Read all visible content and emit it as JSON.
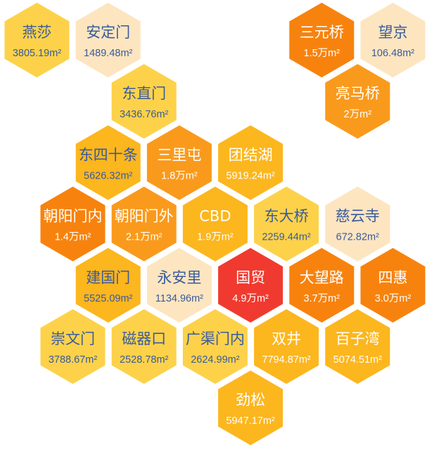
{
  "palette": {
    "light": "#fde5c0",
    "yellow": "#fdd24a",
    "amber": "#fcb61e",
    "orange": "#fa9a1c",
    "deep_orange": "#f7830e",
    "red": "#f13a2f",
    "text_dark_blue": "#3a5a9c",
    "text_white": "#ffffff"
  },
  "hexes": [
    {
      "row": 0,
      "col": 0,
      "name": "燕莎",
      "value": "3805.19m²",
      "fill": "yellow",
      "text": "text_dark_blue"
    },
    {
      "row": 0,
      "col": 1,
      "name": "安定门",
      "value": "1489.48m²",
      "fill": "light",
      "text": "text_dark_blue"
    },
    {
      "row": 0,
      "col": 4,
      "name": "三元桥",
      "value": "1.5万m²",
      "fill": "deep_orange",
      "text": "text_white"
    },
    {
      "row": 0,
      "col": 5,
      "name": "望京",
      "value": "106.48m²",
      "fill": "light",
      "text": "text_dark_blue"
    },
    {
      "row": 1,
      "col": 1,
      "name": "东直门",
      "value": "3436.76m²",
      "fill": "yellow",
      "text": "text_dark_blue"
    },
    {
      "row": 1,
      "col": 4,
      "name": "亮马桥",
      "value": "2万m²",
      "fill": "orange",
      "text": "text_white"
    },
    {
      "row": 2,
      "col": 1,
      "name": "东四十条",
      "value": "5626.32m²",
      "fill": "amber",
      "text": "text_dark_blue"
    },
    {
      "row": 2,
      "col": 2,
      "name": "三里屯",
      "value": "1.8万m²",
      "fill": "orange",
      "text": "text_white"
    },
    {
      "row": 2,
      "col": 3,
      "name": "团结湖",
      "value": "5919.24m²",
      "fill": "amber",
      "text": "text_white"
    },
    {
      "row": 3,
      "col": 0,
      "name": "朝阳门内",
      "value": "1.4万m²",
      "fill": "deep_orange",
      "text": "text_white"
    },
    {
      "row": 3,
      "col": 1,
      "name": "朝阳门外",
      "value": "2.1万m²",
      "fill": "orange",
      "text": "text_white"
    },
    {
      "row": 3,
      "col": 2,
      "name": "CBD",
      "value": "1.9万m²",
      "fill": "amber",
      "text": "text_white"
    },
    {
      "row": 3,
      "col": 3,
      "name": "东大桥",
      "value": "2259.44m²",
      "fill": "yellow",
      "text": "text_dark_blue"
    },
    {
      "row": 3,
      "col": 4,
      "name": "慈云寺",
      "value": "672.82m²",
      "fill": "light",
      "text": "text_dark_blue"
    },
    {
      "row": 4,
      "col": 1,
      "name": "建国门",
      "value": "5525.09m²",
      "fill": "amber",
      "text": "text_dark_blue"
    },
    {
      "row": 4,
      "col": 2,
      "name": "永安里",
      "value": "1134.96m²",
      "fill": "light",
      "text": "text_dark_blue"
    },
    {
      "row": 4,
      "col": 3,
      "name": "国贸",
      "value": "4.9万m²",
      "fill": "red",
      "text": "text_white"
    },
    {
      "row": 4,
      "col": 4,
      "name": "大望路",
      "value": "3.7万m²",
      "fill": "deep_orange",
      "text": "text_white"
    },
    {
      "row": 4,
      "col": 5,
      "name": "四惠",
      "value": "3.0万m²",
      "fill": "deep_orange",
      "text": "text_white"
    },
    {
      "row": 5,
      "col": 0,
      "name": "崇文门",
      "value": "3788.67m²",
      "fill": "yellow",
      "text": "text_dark_blue"
    },
    {
      "row": 5,
      "col": 1,
      "name": "磁器口",
      "value": "2528.78m²",
      "fill": "yellow",
      "text": "text_dark_blue"
    },
    {
      "row": 5,
      "col": 2,
      "name": "广渠门内",
      "value": "2624.99m²",
      "fill": "yellow",
      "text": "text_dark_blue"
    },
    {
      "row": 5,
      "col": 3,
      "name": "双井",
      "value": "7794.87m²",
      "fill": "amber",
      "text": "text_white"
    },
    {
      "row": 5,
      "col": 4,
      "name": "百子湾",
      "value": "5074.51m²",
      "fill": "amber",
      "text": "text_white"
    },
    {
      "row": 6,
      "col": 3,
      "name": "劲松",
      "value": "5947.17m²",
      "fill": "amber",
      "text": "text_white"
    }
  ]
}
